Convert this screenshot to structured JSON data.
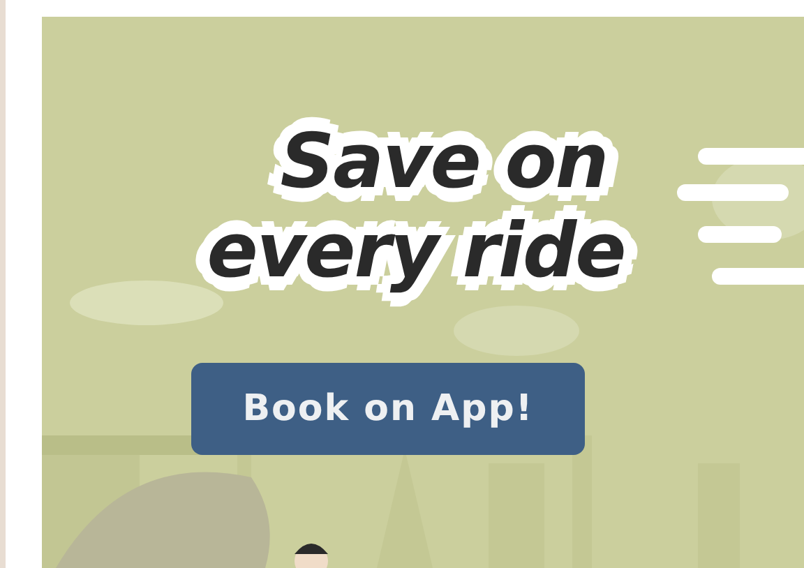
{
  "banner": {
    "headline": [
      "Save on",
      "every ride"
    ],
    "button": "Book on App!"
  }
}
